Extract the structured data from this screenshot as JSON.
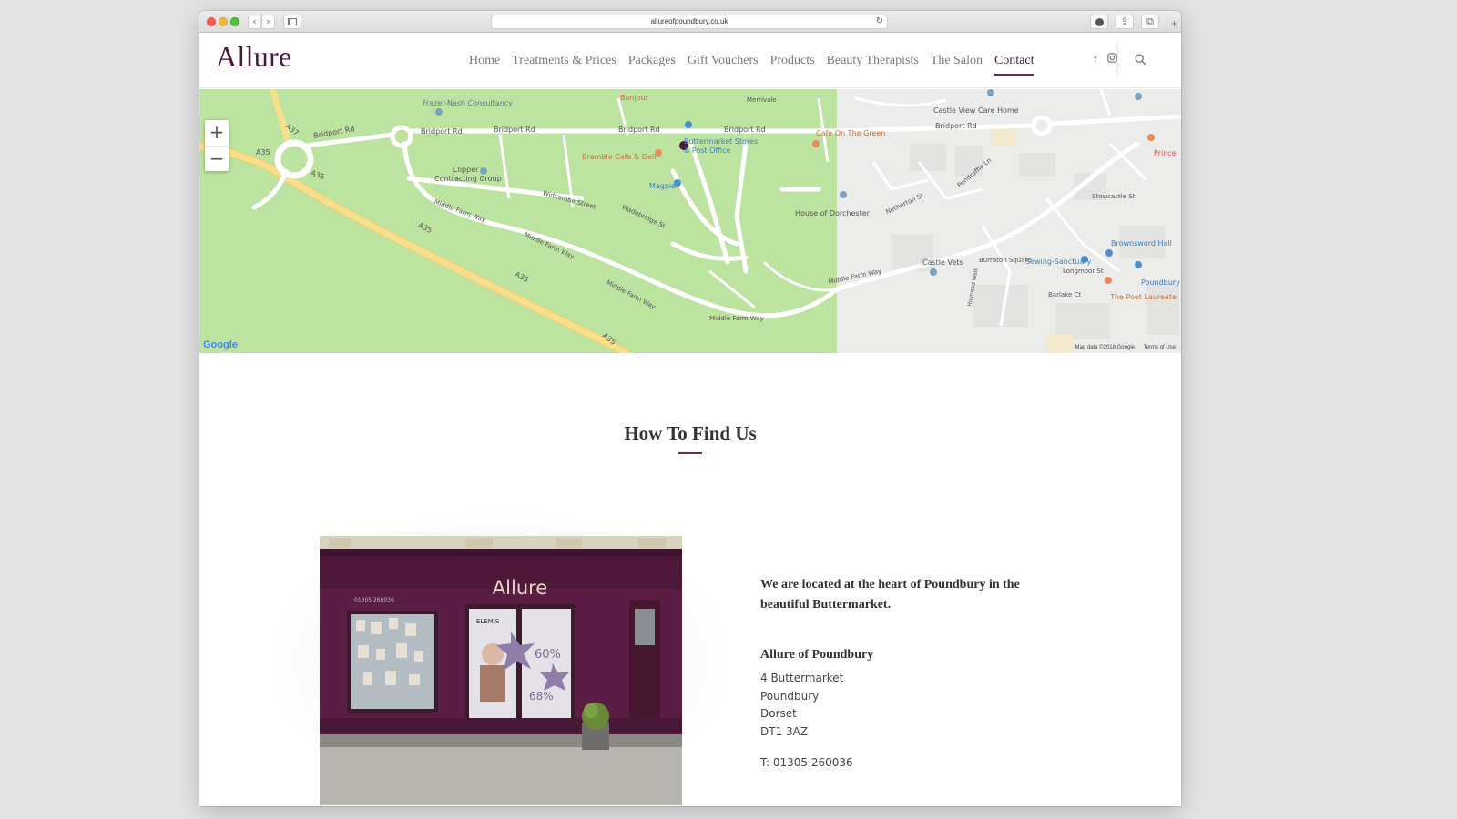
{
  "browser": {
    "url": "allureofpoundbury.co.uk",
    "back_icon": "chevron-left-icon",
    "forward_icon": "chevron-right-icon",
    "reload_icon": "reload-icon"
  },
  "site": {
    "logo": "Allure",
    "nav": [
      {
        "label": "Home",
        "active": false
      },
      {
        "label": "Treatments & Prices",
        "active": false
      },
      {
        "label": "Packages",
        "active": false
      },
      {
        "label": "Gift Vouchers",
        "active": false
      },
      {
        "label": "Products",
        "active": false
      },
      {
        "label": "Beauty Therapists",
        "active": false
      },
      {
        "label": "The Salon",
        "active": false
      },
      {
        "label": "Contact",
        "active": true
      }
    ],
    "social": {
      "facebook": "f",
      "instagram": "instagram-icon"
    }
  },
  "map": {
    "zoom_in": "+",
    "zoom_out": "−",
    "google": "Google",
    "attribution": "Map data ©2018 Google",
    "terms": "Terms of Use",
    "labels": {
      "frazer": "Frazer-Nash Consultancy",
      "bonjour": "Bonjour",
      "bridport1": "Bridport Rd",
      "bridport2": "Bridport Rd",
      "bridport3": "Bridport Rd",
      "bridport4": "Bridport Rd",
      "bridport5": "Bridport Rd",
      "bridport6": "Bridport Rd",
      "a37": "A37",
      "a35a": "A35",
      "a35b": "A35",
      "a35c": "A35",
      "a35d": "A35",
      "a35e": "A35",
      "clipper": "Clipper",
      "contracting": "Contracting Group",
      "bramble": "Bramble Cafe & Deli",
      "buttermarket": "Buttermarket Stores",
      "postoffice": "& Post Office",
      "magpie": "Magpie",
      "cafegreen": "Cafe On The Green",
      "house": "House of Dorchester",
      "castleview": "Castle View Care Home",
      "castlevets": "Castle Vets",
      "sewing": "Sewing-Sanctuary",
      "brownsword": "Brownsword Hall",
      "poet": "The Poet Laureate",
      "poundbury": "Poundbury",
      "prince": "Prince",
      "middlefarm1": "Middle Farm Way",
      "middlefarm2": "Middle Farm Way",
      "middlefarm3": "Middle Farm Way",
      "middlefarm4": "Middle Farm Way",
      "middlefarm5": "Middle Farm Way",
      "widcombe": "Widcombe Street",
      "wadebridge": "Wadebridge St",
      "holmead": "Holmead Walk",
      "burraton": "Burraton Square",
      "longmoor": "Longmoor St",
      "barlake": "Barlake Ct",
      "stowcastle": "Stowcastle St",
      "netherton": "Netherton St",
      "pendruffle": "Pendruffle Ln",
      "merrivale": "Merrivale"
    }
  },
  "content": {
    "title": "How To Find Us",
    "intro": "We are located at the heart of Poundbury in the beautiful Buttermarket.",
    "business_name": "Allure of Poundbury",
    "address": [
      "4 Buttermarket",
      "Poundbury",
      "Dorset",
      "DT1 3AZ"
    ],
    "phone": "T: 01305 260036"
  },
  "photo": {
    "shop_sign": "Allure",
    "shop_phone": "01305 260036",
    "poster_brand": "ELEMIS",
    "poster_pct1": "60%",
    "poster_pct2": "68%"
  },
  "colors": {
    "brand": "#4a1a3c",
    "accent": "#6a2a5c",
    "map_green": "#bfe3a2",
    "road_yellow": "#f7db8a"
  }
}
